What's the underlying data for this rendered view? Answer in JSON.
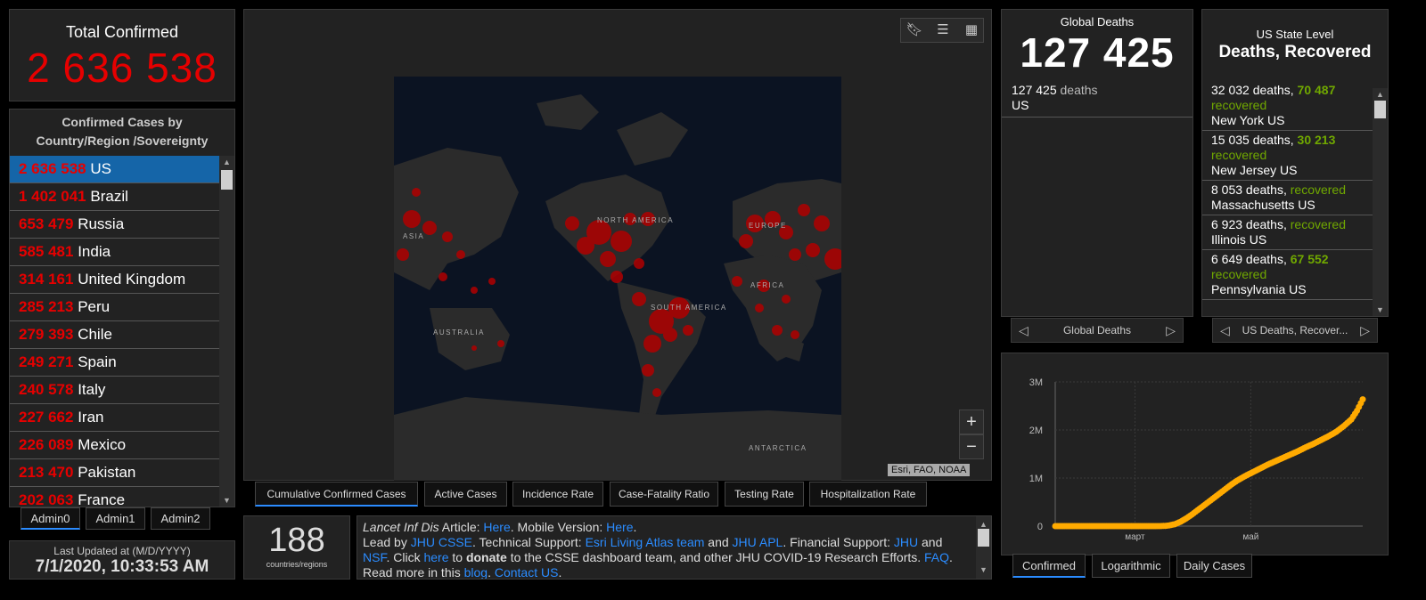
{
  "total": {
    "label": "Total Confirmed",
    "value": "2 636 538"
  },
  "countries": {
    "title": "Confirmed Cases by Country/Region /Sovereignty",
    "items": [
      {
        "value": "2 636 538",
        "name": "US"
      },
      {
        "value": "1 402 041",
        "name": "Brazil"
      },
      {
        "value": "653 479",
        "name": "Russia"
      },
      {
        "value": "585 481",
        "name": "India"
      },
      {
        "value": "314 161",
        "name": "United Kingdom"
      },
      {
        "value": "285 213",
        "name": "Peru"
      },
      {
        "value": "279 393",
        "name": "Chile"
      },
      {
        "value": "249 271",
        "name": "Spain"
      },
      {
        "value": "240 578",
        "name": "Italy"
      },
      {
        "value": "227 662",
        "name": "Iran"
      },
      {
        "value": "226 089",
        "name": "Mexico"
      },
      {
        "value": "213 470",
        "name": "Pakistan"
      },
      {
        "value": "202 063",
        "name": "France"
      }
    ]
  },
  "admin_tabs": [
    "Admin0",
    "Admin1",
    "Admin2"
  ],
  "updated": {
    "label": "Last Updated at (M/D/YYYY)",
    "value": "7/1/2020, 10:33:53 AM"
  },
  "map": {
    "labels": {
      "asia": "ASIA",
      "north_america": "NORTH AMERICA",
      "europe": "EUROPE",
      "africa": "AFRICA",
      "south_america": "SOUTH AMERICA",
      "australia": "AUSTRALIA",
      "antarctica": "ANTARCTICA"
    },
    "attribution": "Esri, FAO, NOAA",
    "zoom_in": "+",
    "zoom_out": "−"
  },
  "map_tabs": [
    "Cumulative Confirmed Cases",
    "Active Cases",
    "Incidence Rate",
    "Case-Fatality Ratio",
    "Testing Rate",
    "Hospitalization Rate"
  ],
  "count": {
    "value": "188",
    "label": "countries/regions"
  },
  "info": {
    "journal": "Lancet Inf Dis",
    "t_article": " Article: ",
    "here1": "Here",
    "t_mobile": ". Mobile Version: ",
    "here2": "Here",
    "t_dot1": ".",
    "t_lead": "Lead by ",
    "jhu_csse": "JHU CSSE",
    "t_tech": ". Technical Support: ",
    "esri": "Esri Living Atlas team",
    "t_and1": " and ",
    "jhu_apl": "JHU APL",
    "t_fin": ". Financial Support: ",
    "jhu": "JHU",
    "t_and2": " and",
    "nsf": "NSF",
    "t_click": ". Click ",
    "here3": "here",
    "t_to": " to ",
    "donate": "donate",
    "t_rest": " to the CSSE dashboard team, and other JHU COVID-19 Research Efforts. ",
    "faq": "FAQ",
    "t_read": ". Read more in this ",
    "blog": "blog",
    "t_dot2": ". ",
    "contact": "Contact US",
    "t_dot3": "."
  },
  "global_deaths": {
    "label": "Global Deaths",
    "value": "127 425",
    "row_value": "127 425",
    "row_unit": "deaths",
    "row_place": "US",
    "pager_label": "Global Deaths"
  },
  "us_state": {
    "label": "US State Level",
    "title": "Deaths, Recovered",
    "pager_label": "US Deaths, Recover...",
    "items": [
      {
        "deaths": "32 032 deaths, ",
        "recovered_value": "70 487",
        "recovered_label": "recovered",
        "place": "New York US"
      },
      {
        "deaths": "15 035 deaths, ",
        "recovered_value": "30 213",
        "recovered_label": "recovered",
        "place": "New Jersey US"
      },
      {
        "deaths": "8 053 deaths, ",
        "recovered_value": "",
        "recovered_label": "recovered",
        "place": "Massachusetts US"
      },
      {
        "deaths": "6 923 deaths, ",
        "recovered_value": "",
        "recovered_label": "recovered",
        "place": "Illinois US"
      },
      {
        "deaths": "6 649 deaths, ",
        "recovered_value": "67 552",
        "recovered_label": "recovered",
        "place": "Pennsylvania US"
      }
    ]
  },
  "chart_tabs": [
    "Confirmed",
    "Logarithmic",
    "Daily Cases"
  ],
  "colors": {
    "confirmed_red": "#e60000",
    "recovered_green": "#70a800",
    "link_blue": "#2b8cff",
    "series_orange": "#ffaa00"
  },
  "chart_data": {
    "type": "scatter",
    "series_name": "Confirmed",
    "x_ticks": [
      "март",
      "май"
    ],
    "y_ticks": [
      "0",
      "1M",
      "2M",
      "3M"
    ],
    "ylim": [
      0,
      3000000
    ],
    "x_ticks_at_day": [
      42,
      103
    ],
    "day_range": [
      0,
      162
    ],
    "points": [
      [
        0,
        0
      ],
      [
        10,
        0
      ],
      [
        20,
        0
      ],
      [
        30,
        0
      ],
      [
        40,
        0
      ],
      [
        45,
        50
      ],
      [
        50,
        100
      ],
      [
        55,
        1000
      ],
      [
        58,
        5000
      ],
      [
        60,
        15000
      ],
      [
        63,
        40000
      ],
      [
        66,
        90000
      ],
      [
        69,
        160000
      ],
      [
        72,
        240000
      ],
      [
        75,
        330000
      ],
      [
        78,
        420000
      ],
      [
        81,
        510000
      ],
      [
        84,
        600000
      ],
      [
        87,
        690000
      ],
      [
        90,
        780000
      ],
      [
        93,
        870000
      ],
      [
        96,
        950000
      ],
      [
        100,
        1040000
      ],
      [
        104,
        1120000
      ],
      [
        108,
        1200000
      ],
      [
        112,
        1280000
      ],
      [
        116,
        1350000
      ],
      [
        120,
        1420000
      ],
      [
        124,
        1490000
      ],
      [
        128,
        1560000
      ],
      [
        132,
        1640000
      ],
      [
        136,
        1710000
      ],
      [
        140,
        1790000
      ],
      [
        144,
        1870000
      ],
      [
        148,
        1960000
      ],
      [
        152,
        2080000
      ],
      [
        156,
        2220000
      ],
      [
        159,
        2400000
      ],
      [
        162,
        2636538
      ]
    ]
  }
}
